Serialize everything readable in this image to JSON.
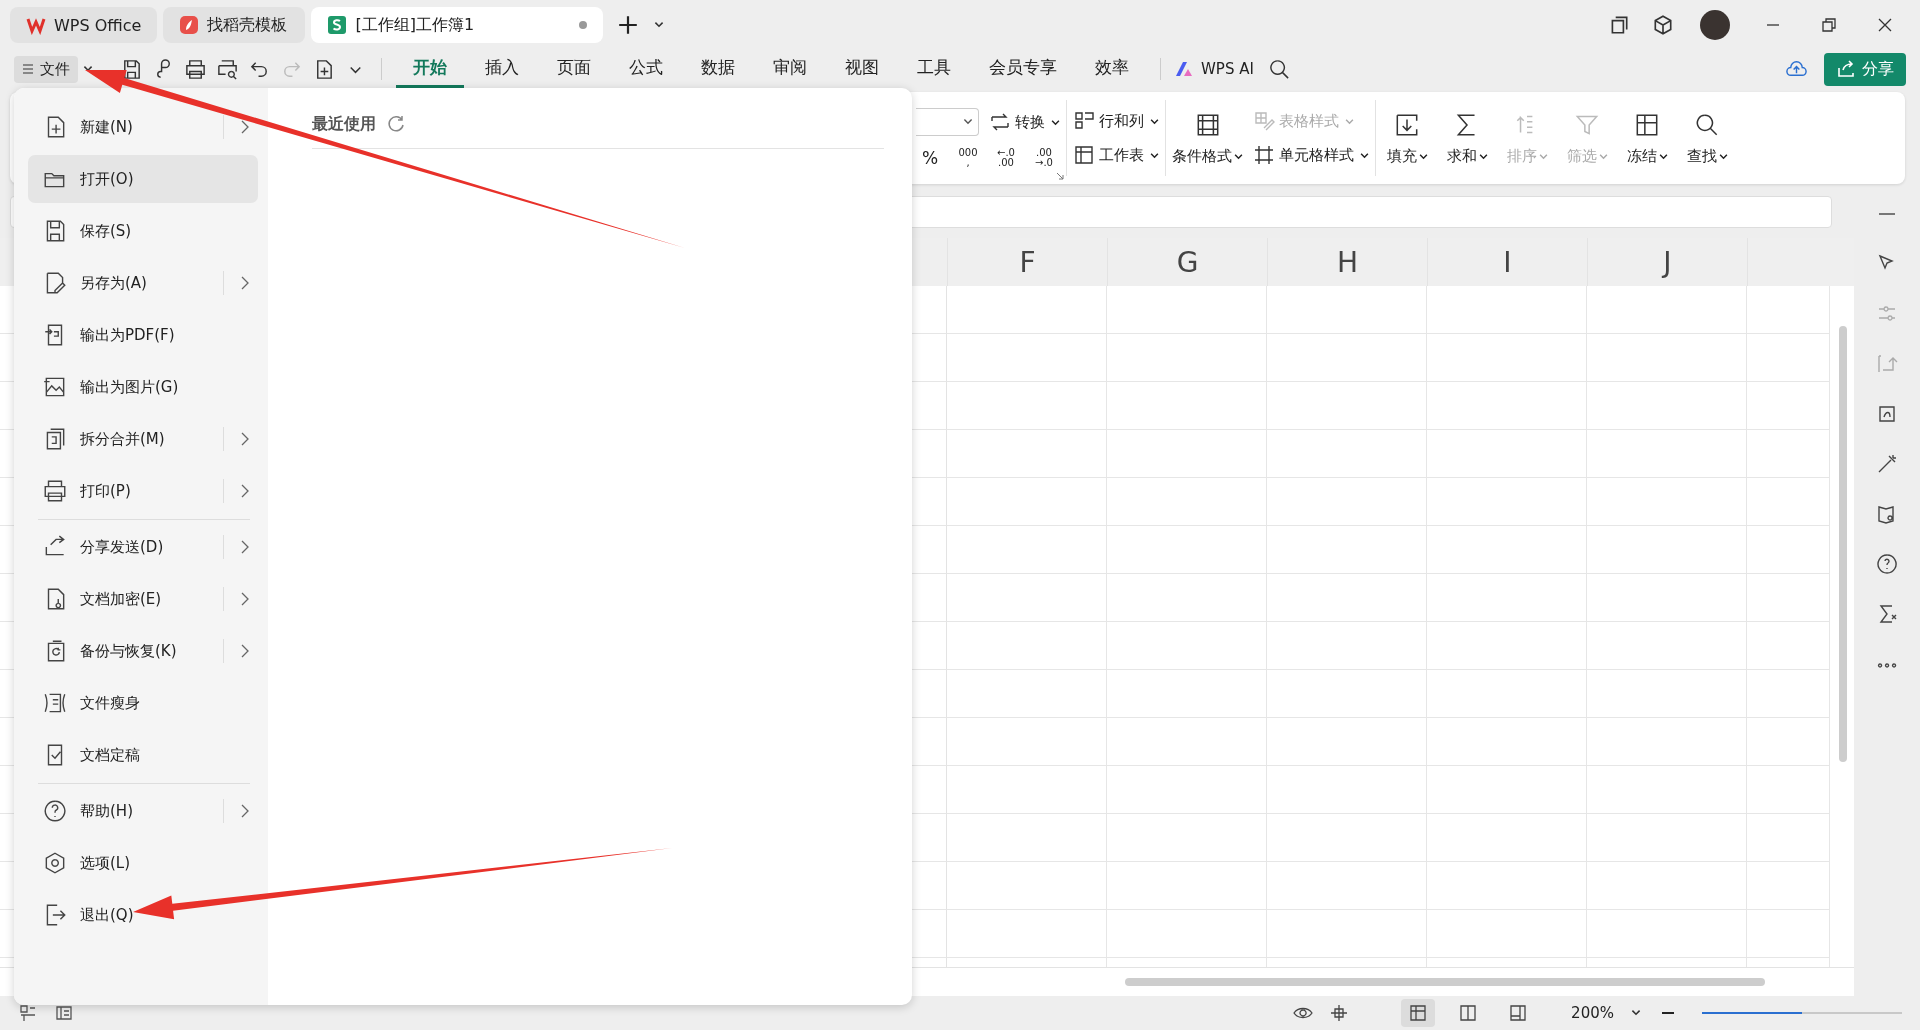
{
  "window_tabs": [
    {
      "label": "WPS Office",
      "kind": "home",
      "selected": false
    },
    {
      "label": "找稻壳模板",
      "kind": "template",
      "selected": false
    },
    {
      "label": "[工作组]工作簿1",
      "kind": "sheet",
      "selected": true
    }
  ],
  "file_button": {
    "label": "文件"
  },
  "ribbon_tabs": [
    {
      "label": "开始",
      "selected": true
    },
    {
      "label": "插入",
      "selected": false
    },
    {
      "label": "页面",
      "selected": false
    },
    {
      "label": "公式",
      "selected": false
    },
    {
      "label": "数据",
      "selected": false
    },
    {
      "label": "审阅",
      "selected": false
    },
    {
      "label": "视图",
      "selected": false
    },
    {
      "label": "工具",
      "selected": false
    },
    {
      "label": "会员专享",
      "selected": false
    },
    {
      "label": "效率",
      "selected": false
    }
  ],
  "ai_button": {
    "label": "WPS AI"
  },
  "share_button": {
    "label": "分享"
  },
  "ribbon_groups": [
    {
      "kind": "stack",
      "rows": [
        [
          {
            "kind": "dropdown"
          },
          {
            "kind": "small",
            "label": "转换",
            "dropdown": true,
            "disabled": false
          }
        ],
        [
          {
            "kind": "text",
            "lines": [
              "%"
            ]
          },
          {
            "kind": "text",
            "lines": [
              "000",
              ","
            ]
          },
          {
            "kind": "text",
            "lines": [
              "←.0",
              ".00"
            ]
          },
          {
            "kind": "text",
            "lines": [
              ".00",
              "→.0"
            ]
          }
        ]
      ]
    },
    {
      "kind": "stack",
      "rows": [
        [
          {
            "kind": "small",
            "label": "行和列",
            "dropdown": true,
            "disabled": false
          }
        ],
        [
          {
            "kind": "small",
            "label": "工作表",
            "dropdown": true,
            "disabled": false
          }
        ]
      ]
    },
    {
      "kind": "mixed",
      "large": [
        {
          "label": "条件格式",
          "dropdown": true,
          "disabled": false
        }
      ],
      "rows": [
        [
          {
            "kind": "small",
            "label": "表格样式",
            "dropdown": true,
            "disabled": true
          }
        ],
        [
          {
            "kind": "small",
            "label": "单元格样式",
            "dropdown": true,
            "disabled": false
          }
        ]
      ]
    },
    {
      "kind": "large",
      "large": [
        {
          "label": "填充",
          "dropdown": true,
          "disabled": false
        },
        {
          "label": "求和",
          "dropdown": true,
          "disabled": false
        },
        {
          "label": "排序",
          "dropdown": true,
          "disabled": true
        },
        {
          "label": "筛选",
          "dropdown": true,
          "disabled": true
        },
        {
          "label": "冻结",
          "dropdown": true,
          "disabled": false
        },
        {
          "label": "查找",
          "dropdown": true,
          "disabled": false
        }
      ]
    }
  ],
  "file_menu": {
    "groups": [
      [
        {
          "label": "新建(N)",
          "selected": false,
          "submenu": true
        },
        {
          "label": "打开(O)",
          "selected": true,
          "submenu": false
        },
        {
          "label": "保存(S)",
          "selected": false,
          "submenu": false
        },
        {
          "label": "另存为(A)",
          "selected": false,
          "submenu": true
        },
        {
          "label": "输出为PDF(F)",
          "selected": false,
          "submenu": false
        },
        {
          "label": "输出为图片(G)",
          "selected": false,
          "submenu": false
        },
        {
          "label": "拆分合并(M)",
          "selected": false,
          "submenu": true
        },
        {
          "label": "打印(P)",
          "selected": false,
          "submenu": true
        }
      ],
      [
        {
          "label": "分享发送(D)",
          "selected": false,
          "submenu": true
        },
        {
          "label": "文档加密(E)",
          "selected": false,
          "submenu": true
        },
        {
          "label": "备份与恢复(K)",
          "selected": false,
          "submenu": true
        },
        {
          "label": "文件瘦身",
          "selected": false,
          "submenu": false
        },
        {
          "label": "文档定稿",
          "selected": false,
          "submenu": false
        }
      ],
      [
        {
          "label": "帮助(H)",
          "selected": false,
          "submenu": true
        },
        {
          "label": "选项(L)",
          "selected": false,
          "submenu": false
        },
        {
          "label": "退出(Q)",
          "selected": false,
          "submenu": false
        }
      ]
    ],
    "recent_title": "最近使用"
  },
  "columns": [
    "F",
    "G",
    "H",
    "I",
    "J"
  ],
  "status_bar": {
    "views": [
      {
        "selected": true
      },
      {
        "selected": false
      },
      {
        "selected": false
      }
    ],
    "zoom": "200%",
    "zoom_slider": {
      "level": 0.5
    }
  }
}
